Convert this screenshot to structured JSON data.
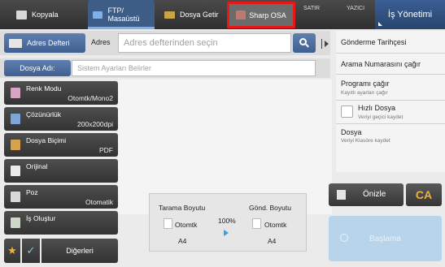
{
  "top_tabs": {
    "kopyala": "Kopyala",
    "ftp_line1": "FTP/",
    "ftp_line2": "Masaüstü",
    "dosya": "Dosya Getir",
    "sharp": "Sharp OSA",
    "satir": "SATIR",
    "yazici": "YAZICI",
    "job_status": "İş Yönetimi"
  },
  "address": {
    "book_button": "Adres Defteri",
    "label": "Adres",
    "placeholder": "Adres defterinden seçin"
  },
  "file_name": {
    "label": "Dosya Adı:",
    "placeholder": "Sistem Ayarları Belirler"
  },
  "settings": [
    {
      "name": "Renk Modu",
      "value": "Otomtk/Mono2"
    },
    {
      "name": "Çözünürlük",
      "value": "200x200dpi"
    },
    {
      "name": "Dosya Biçimi",
      "value": "PDF"
    },
    {
      "name": "Orijinal",
      "value": ""
    },
    {
      "name": "Poz",
      "value": "Otomatik"
    },
    {
      "name": "İş Oluştur",
      "value": ""
    }
  ],
  "bottom": {
    "star": "★",
    "check": "✓",
    "others": "Diğerleri"
  },
  "scan_size": {
    "scan_title": "Tarama Boyutu",
    "send_title": "Gönd. Boyutu",
    "scan_auto": "Otomtk",
    "send_auto": "Otomtk",
    "ratio": "100%",
    "scan_paper": "A4",
    "send_paper": "A4"
  },
  "right_panel": {
    "history": "Gönderme Tarihçesi",
    "recall_number": "Arama Numarasını çağır",
    "recall_program": "Programı çağır",
    "recall_program_sub": "Kayıtlı ayarları çağır",
    "quick_file": "Hızlı Dosya",
    "quick_file_sub": "Veriyi geçici kaydet",
    "file": "Dosya",
    "file_sub": "Veriyi Klasöre kaydet"
  },
  "actions": {
    "preview": "Önizle",
    "ca": "CA",
    "start": "Başlama"
  }
}
